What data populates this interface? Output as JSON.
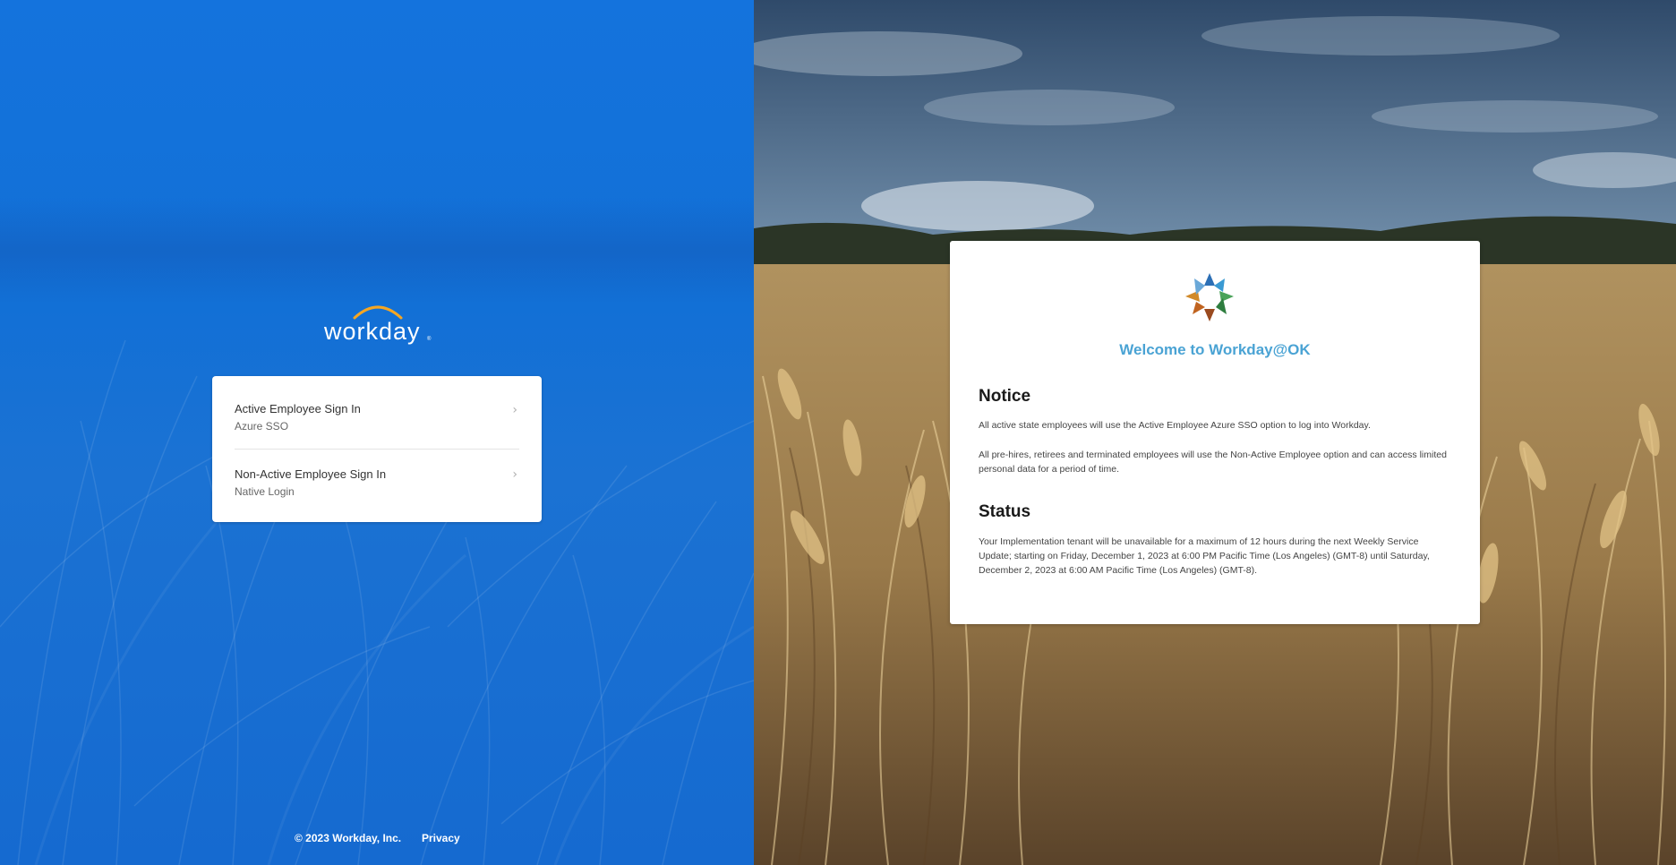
{
  "brand": {
    "logo_text": "workday",
    "logo_accent_color": "#f5a623"
  },
  "signin": {
    "options": [
      {
        "title": "Active Employee Sign In",
        "subtitle": "Azure SSO"
      },
      {
        "title": "Non-Active Employee Sign In",
        "subtitle": "Native Login"
      }
    ]
  },
  "footer": {
    "copyright": "© 2023 Workday, Inc.",
    "privacy": "Privacy"
  },
  "notice_card": {
    "welcome": "Welcome to Workday@OK",
    "notice_heading": "Notice",
    "notice_p1": "All active state employees will use the Active Employee Azure SSO option to log into Workday.",
    "notice_p2": "All pre-hires, retirees and terminated employees will use the Non-Active Employee option and can access limited personal data for a period of time.",
    "status_heading": "Status",
    "status_p1": "Your Implementation tenant will be unavailable for a maximum of 12 hours during the next Weekly Service Update; starting on Friday, December 1, 2023 at 6:00 PM Pacific Time (Los Angeles) (GMT-8) until Saturday, December 2, 2023 at 6:00 AM Pacific Time (Los Angeles) (GMT-8)."
  },
  "colors": {
    "left_panel_blue": "#1473dd",
    "welcome_text": "#4aa3d4"
  }
}
